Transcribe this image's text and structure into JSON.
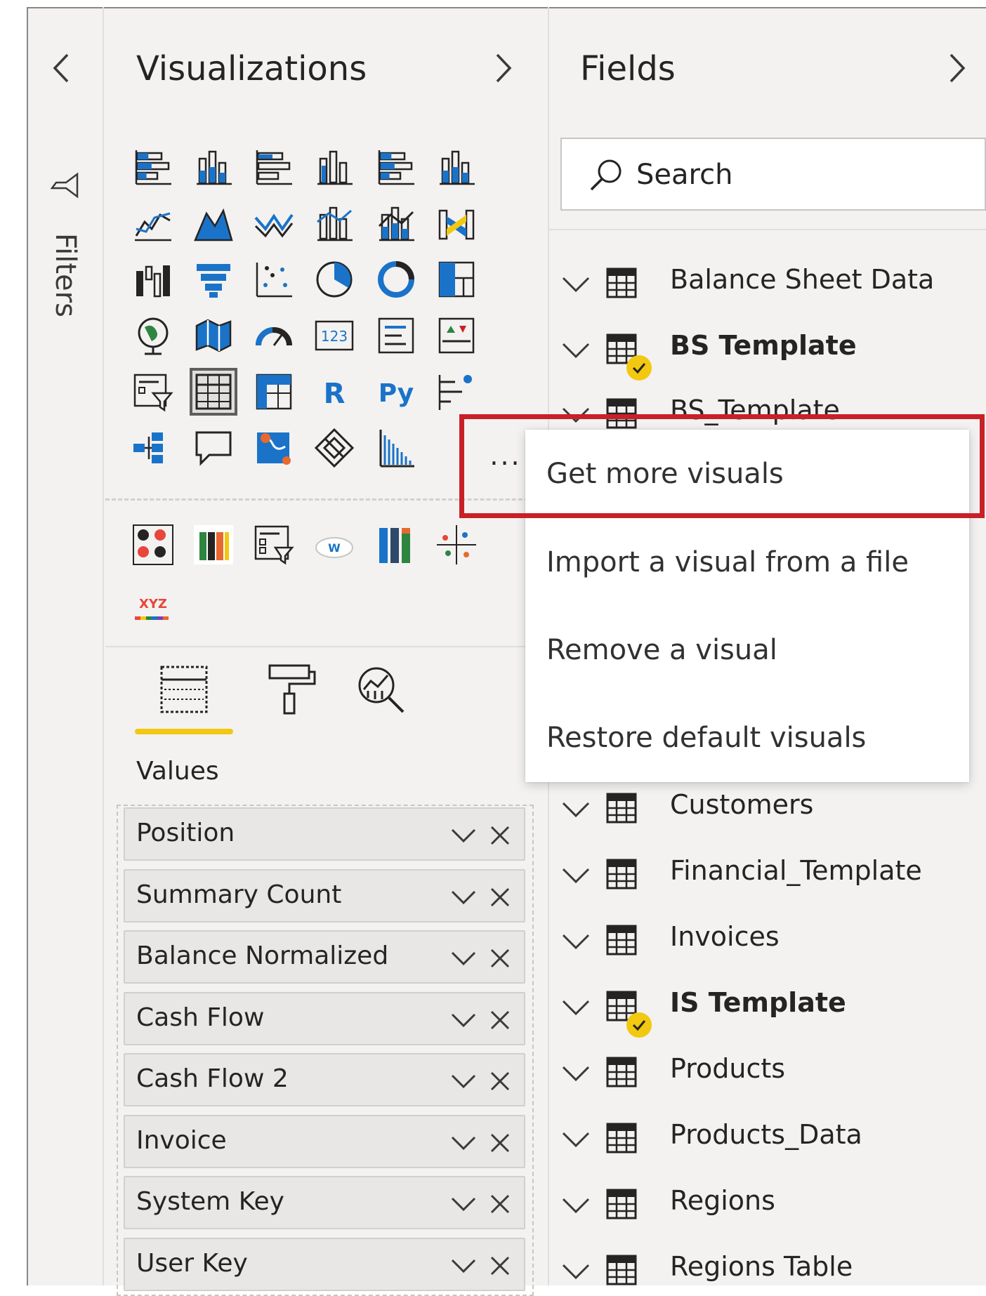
{
  "filters": {
    "label": "Filters",
    "collapse_icon": "chevron-left-icon",
    "icon": "funnel-icon"
  },
  "visualizations": {
    "title": "Visualizations",
    "expand_icon": "chevron-right-icon",
    "more_label": "...",
    "build_icons": [
      "stacked-bar-icon",
      "stacked-column-icon",
      "clustered-bar-icon",
      "clustered-column-icon",
      "100-stacked-bar-icon",
      "100-stacked-column-icon",
      "line-chart-icon",
      "area-chart-icon",
      "stacked-area-icon",
      "line-clustered-column-icon",
      "line-stacked-column-icon",
      "ribbon-chart-icon",
      "waterfall-icon",
      "funnel-chart-icon",
      "scatter-icon",
      "pie-chart-icon",
      "donut-chart-icon",
      "treemap-icon",
      "map-icon",
      "filled-map-icon",
      "gauge-icon",
      "card-icon",
      "multi-row-card-icon",
      "kpi-icon",
      "slicer-icon",
      "table-icon",
      "matrix-icon",
      "r-visual-icon",
      "python-visual-icon",
      "key-influencers-icon",
      "decomposition-tree-icon",
      "qa-icon",
      "arcgis-map-icon",
      "power-apps-icon",
      "chiclet-icon"
    ],
    "r_label": "R",
    "py_label": "Py",
    "card_label": "123",
    "custom_icons": [
      "custom-visual-dots-icon",
      "custom-visual-bar-icon",
      "custom-visual-slicer-icon",
      "custom-visual-wordcloud-icon",
      "custom-visual-columns-icon",
      "custom-visual-scatter-icon",
      "custom-visual-xyz-icon"
    ],
    "xyz_label": "XYZ",
    "cloud_label": "W",
    "tabs": [
      "fields-tab-icon",
      "format-tab-icon",
      "analytics-tab-icon"
    ],
    "values_title": "Values",
    "values": [
      "Position",
      "Summary Count",
      "Balance Normalized",
      "Cash Flow",
      "Cash Flow 2",
      "Invoice",
      "System Key",
      "User Key"
    ]
  },
  "fields": {
    "title": "Fields",
    "expand_icon": "chevron-right-icon",
    "search_placeholder": "Search",
    "tables": [
      {
        "name": "Balance Sheet Data",
        "bold": false,
        "badge": false
      },
      {
        "name": "BS Template",
        "bold": true,
        "badge": true
      },
      {
        "name": "BS_Template",
        "bold": false,
        "badge": false
      },
      {
        "name": "Customers",
        "bold": false,
        "badge": false
      },
      {
        "name": "Financial_Template",
        "bold": false,
        "badge": false
      },
      {
        "name": "Invoices",
        "bold": false,
        "badge": false
      },
      {
        "name": "IS Template",
        "bold": true,
        "badge": true
      },
      {
        "name": "Products",
        "bold": false,
        "badge": false
      },
      {
        "name": "Products_Data",
        "bold": false,
        "badge": false
      },
      {
        "name": "Regions",
        "bold": false,
        "badge": false
      },
      {
        "name": "Regions Table",
        "bold": false,
        "badge": false
      }
    ]
  },
  "menu": {
    "items": [
      "Get more visuals",
      "Import a visual from a file",
      "Remove a visual",
      "Restore default visuals"
    ],
    "highlight_color": "#c82027"
  },
  "colors": {
    "accent_yellow": "#f2c811",
    "icon_blue": "#1a73c8",
    "icon_dark": "#252423"
  }
}
